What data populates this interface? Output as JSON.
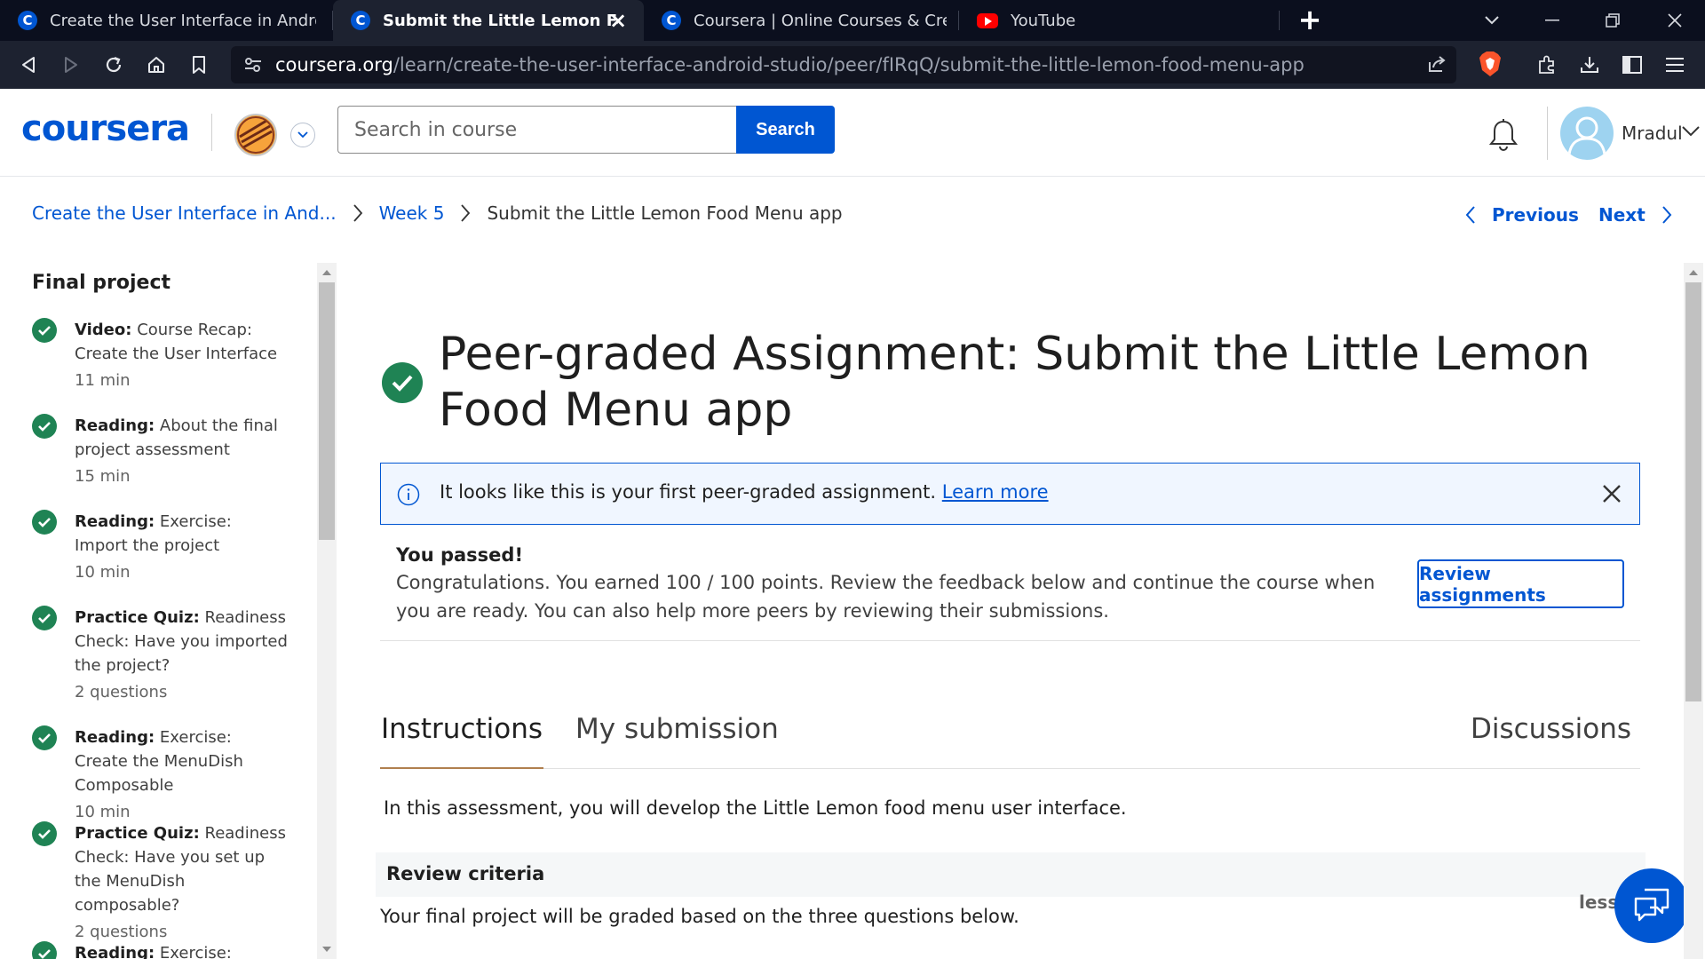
{
  "browser": {
    "tabs": [
      {
        "title": "Create the User Interface in Android St",
        "favicon": "coursera-icon"
      },
      {
        "title": "Submit the Little Lemon Food Me",
        "favicon": "coursera-icon",
        "active": true
      },
      {
        "title": "Coursera | Online Courses & Credenti",
        "favicon": "coursera-icon"
      },
      {
        "title": "YouTube",
        "favicon": "youtube-icon"
      }
    ],
    "url_domain": "coursera.org",
    "url_path": "/learn/create-the-user-interface-android-studio/peer/fIRqQ/submit-the-little-lemon-food-menu-app"
  },
  "header": {
    "logo": "coursera",
    "search_placeholder": "Search in course",
    "search_button": "Search",
    "username": "Mradul"
  },
  "breadcrumb": {
    "course": "Create the User Interface in And...",
    "week": "Week 5",
    "current": "Submit the Little Lemon Food Menu app"
  },
  "pager": {
    "previous": "Previous",
    "next": "Next"
  },
  "sidebar": {
    "title": "Final project",
    "items": [
      {
        "type": "Video:",
        "title": "Course Recap: Create the User Interface",
        "meta": "11 min"
      },
      {
        "type": "Reading:",
        "title": "About the final project assessment",
        "meta": "15 min"
      },
      {
        "type": "Reading:",
        "title": "Exercise: Import the project",
        "meta": "10 min"
      },
      {
        "type": "Practice Quiz:",
        "title": "Readiness Check: Have you imported the project?",
        "meta": "2 questions"
      },
      {
        "type": "Reading:",
        "title": "Exercise: Create the MenuDish Composable",
        "meta": "10 min"
      },
      {
        "type": "Practice Quiz:",
        "title": "Readiness Check: Have you set up the MenuDish composable?",
        "meta": "2 questions"
      },
      {
        "type": "Reading:",
        "title": "Exercise: Create",
        "meta": ""
      }
    ]
  },
  "main": {
    "title": "Peer-graded Assignment: Submit the Little Lemon Food Menu app",
    "banner_text": "It looks like this is your first peer-graded assignment.",
    "banner_link": "Learn more",
    "passed_title": "You passed!",
    "passed_body": "Congratulations. You earned 100 / 100 points. Review the feedback below and continue the course when you are ready. You can also help more peers by reviewing their submissions.",
    "review_button": "Review assignments",
    "tabs": [
      "Instructions",
      "My submission",
      "Discussions"
    ],
    "intro": "In this assessment, you will develop the Little Lemon food menu user interface.",
    "review_criteria_title": "Review criteria",
    "review_criteria_body": "Your final project will be graded based on the three questions below.",
    "less": "less"
  },
  "colors": {
    "brand": "#0056d2",
    "success": "#1f8354",
    "tab_accent": "#b07f4e"
  }
}
